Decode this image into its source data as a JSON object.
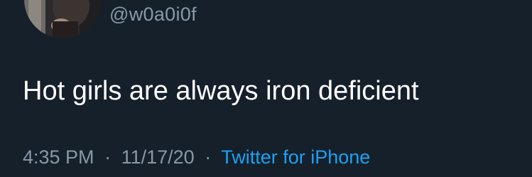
{
  "tweet": {
    "handle": "@w0a0i0f",
    "text": "Hot girls are always iron deficient",
    "time": "4:35 PM",
    "date": "11/17/20",
    "separator": "·",
    "source": "Twitter for iPhone"
  },
  "colors": {
    "background": "#15202b",
    "primary_text": "#ffffff",
    "secondary_text": "#8899a6",
    "link": "#1da1f2"
  }
}
